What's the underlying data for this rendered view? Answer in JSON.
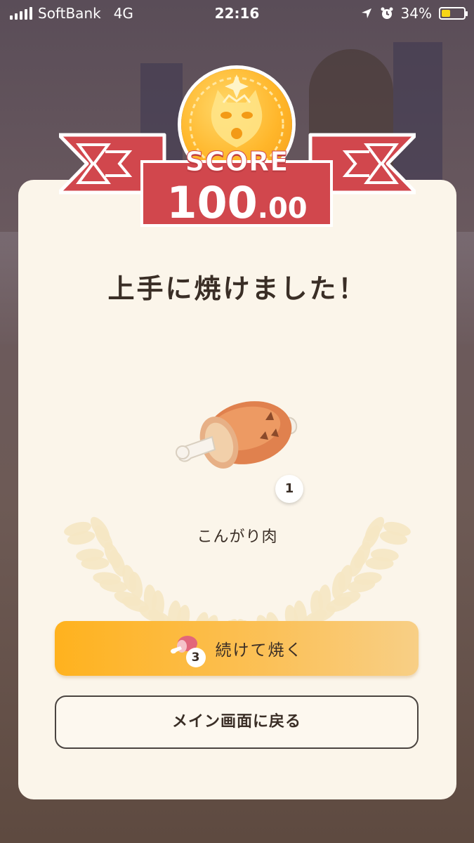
{
  "status_bar": {
    "carrier": "SoftBank",
    "network": "4G",
    "time": "22:16",
    "battery_percent": "34%",
    "battery_level": 0.34,
    "icons": [
      "location-arrow-icon",
      "alarm-icon",
      "battery-icon"
    ]
  },
  "score": {
    "label": "SCORE",
    "integer": "100",
    "decimal": ".00"
  },
  "result": {
    "title": "上手に焼けました！",
    "item_name": "こんがり肉",
    "item_count": "1"
  },
  "buttons": {
    "continue_label": "続けて焼く",
    "continue_count": "3",
    "back_label": "メイン画面に戻る"
  },
  "colors": {
    "ribbon": "#d1474d",
    "card": "#fbf5ea",
    "primary_button": "#ffb21e",
    "text": "#3a2e26"
  }
}
